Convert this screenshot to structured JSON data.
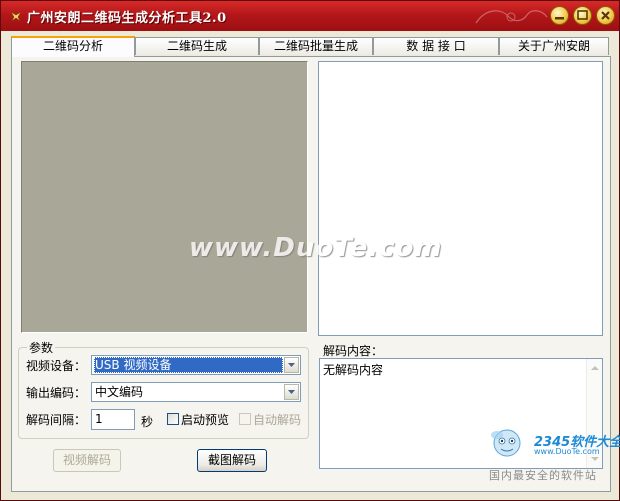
{
  "window": {
    "title": "广州安朗二维码生成分析工具2.0",
    "controls": {
      "minimize": "minimize-icon",
      "restore": "restore-icon",
      "close": "close-icon"
    }
  },
  "tabs": [
    {
      "label": "二维码分析",
      "active": true
    },
    {
      "label": "二维码生成",
      "active": false
    },
    {
      "label": "二维码批量生成",
      "active": false
    },
    {
      "label": "数 据 接 口",
      "active": false
    },
    {
      "label": "关于广州安朗",
      "active": false
    }
  ],
  "watermark": "www.DuoTe.com",
  "params": {
    "group_title": "参数",
    "device_label": "视频设备：",
    "device_value": "USB 视频设备",
    "encoding_label": "输出编码：",
    "encoding_value": "中文编码",
    "interval_label": "解码间隔：",
    "interval_value": "1",
    "interval_unit": "秒",
    "preview_label": "启动预览",
    "auto_decode_label": "自动解码"
  },
  "buttons": {
    "video_decode": "视频解码",
    "capture_decode": "截图解码"
  },
  "result": {
    "label": "解码内容：",
    "content": "无解码内容"
  },
  "branding": {
    "logo": "2345软件大全",
    "url": "www.DuoTe.com",
    "slogan": "国内最安全的软件站"
  },
  "colors": {
    "titlebar": "#b3171a",
    "tab_accent": "#f3a40a",
    "video_bg": "#a9a797",
    "selection": "#316ac5"
  }
}
